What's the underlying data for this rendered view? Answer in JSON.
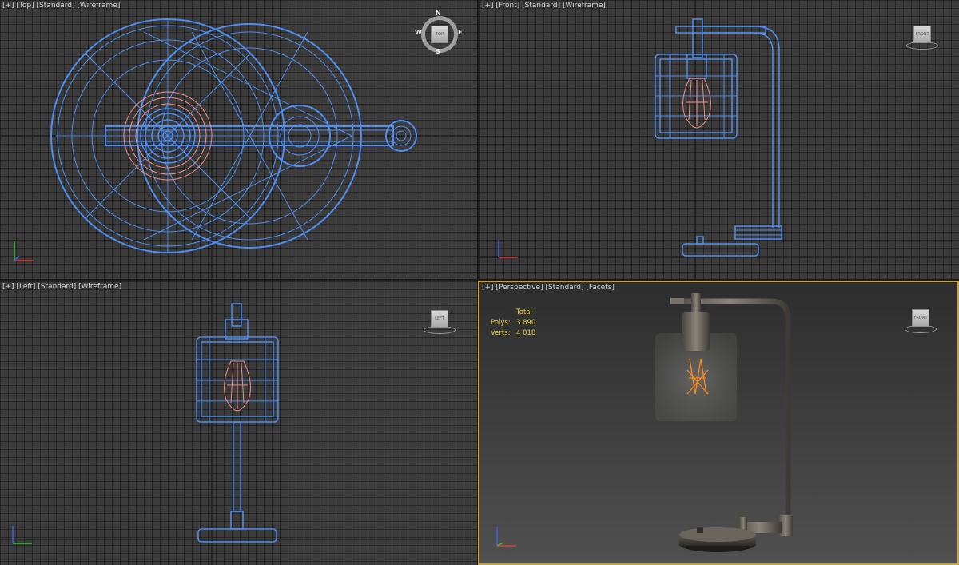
{
  "viewports": {
    "top": {
      "label": [
        "[+]",
        "[Top]",
        "[Standard]",
        "[Wireframe]"
      ],
      "cube": "TOP"
    },
    "front": {
      "label": [
        "[+]",
        "[Front]",
        "[Standard]",
        "[Wireframe]"
      ],
      "cube": "FRONT"
    },
    "left": {
      "label": [
        "[+]",
        "[Left]",
        "[Standard]",
        "[Wireframe]"
      ],
      "cube": "LEFT"
    },
    "perspective": {
      "label": [
        "[+]",
        "[Perspective]",
        "[Standard]",
        "[Facets]"
      ],
      "cube": "FRONT"
    }
  },
  "compass": {
    "n": "N",
    "s": "S",
    "e": "E",
    "w": "W"
  },
  "stats": {
    "header": "Total",
    "polys_label": "Polys:",
    "polys_value": "3 890",
    "verts_label": "Verts:",
    "verts_value": "4 018"
  },
  "colors": {
    "wire": "#4f8ef0",
    "bulb": "#f08f86",
    "active_border": "#c7a13f",
    "stats": "#e8d24a"
  }
}
